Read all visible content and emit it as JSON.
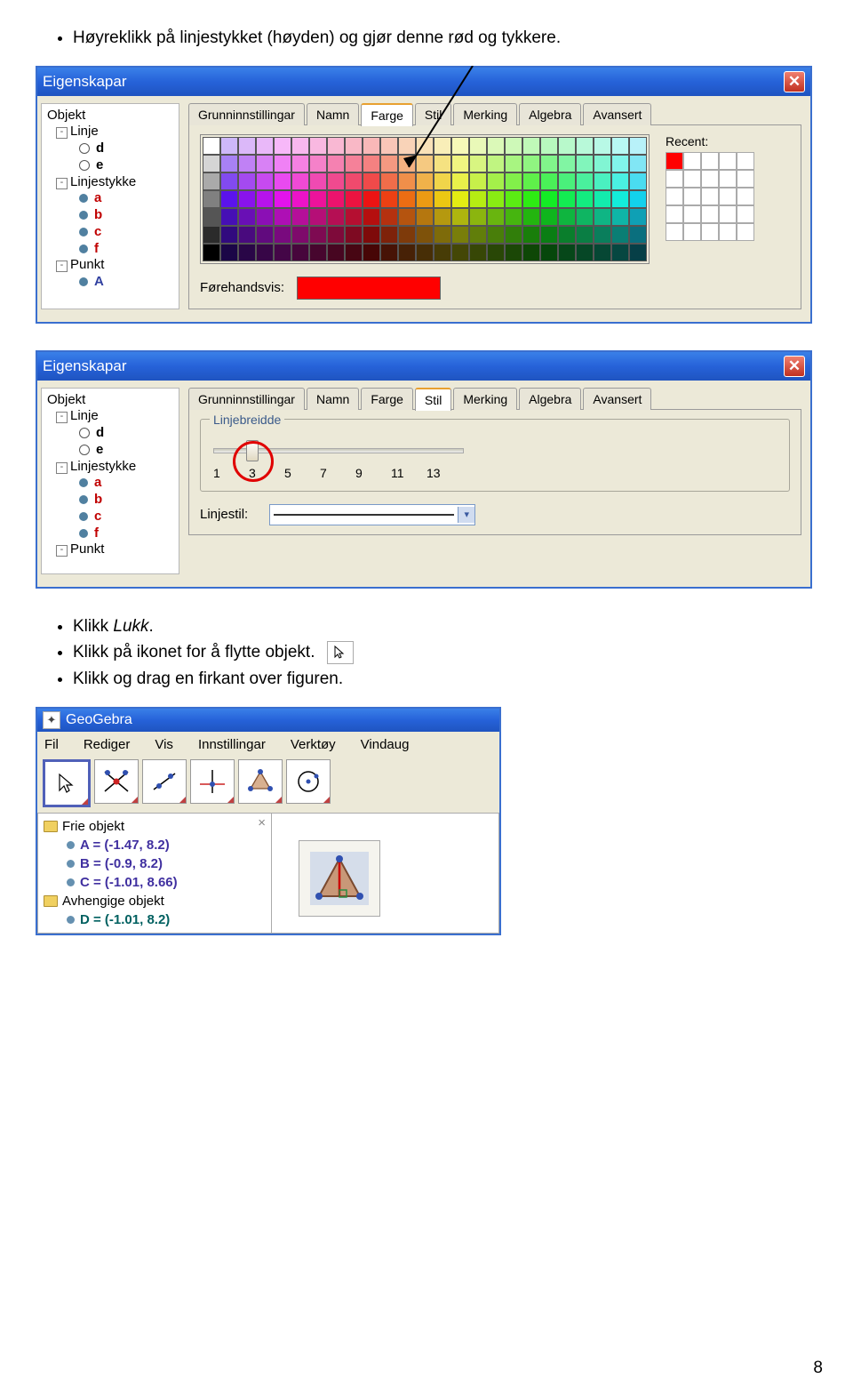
{
  "bullets_top": [
    "Høyreklikk på linjestykket (høyden) og gjør denne rød og tykkere."
  ],
  "bullets_mid": [
    {
      "text": "Klikk ",
      "italic": "Lukk",
      "after": "."
    },
    {
      "text": "Klikk på ikonet for å flytte objekt."
    },
    {
      "text": "Klikk og drag en firkant over figuren."
    }
  ],
  "panel1": {
    "title": "Eigenskapar",
    "tabs": [
      "Grunninnstillingar",
      "Namn",
      "Farge",
      "Stil",
      "Merking",
      "Algebra",
      "Avansert"
    ],
    "active_tab": "Farge",
    "tree_top": "Objekt",
    "tree_linje": "Linje",
    "tree_d": "d",
    "tree_e": "e",
    "tree_ls": "Linjestykke",
    "tree_a": "a",
    "tree_b": "b",
    "tree_c": "c",
    "tree_f": "f",
    "tree_punkt": "Punkt",
    "tree_A": "A",
    "recent_label": "Recent:",
    "preview_label": "Førehandsvis:"
  },
  "panel2": {
    "title": "Eigenskapar",
    "tabs": [
      "Grunninnstillingar",
      "Namn",
      "Farge",
      "Stil",
      "Merking",
      "Algebra",
      "Avansert"
    ],
    "active_tab": "Stil",
    "group_label": "Linjebreidde",
    "ticks": [
      "1",
      "3",
      "5",
      "7",
      "9",
      "11",
      "13"
    ],
    "linjestil_label": "Linjestil:"
  },
  "geogebra": {
    "title": "GeoGebra",
    "menu": [
      "Fil",
      "Rediger",
      "Vis",
      "Innstillingar",
      "Verktøy",
      "Vindaug"
    ],
    "free_label": "Frie objekt",
    "A": "A = (-1.47, 8.2)",
    "B": "B = (-0.9, 8.2)",
    "C": "C = (-1.01, 8.66)",
    "dep_label": "Avhengige objekt",
    "D": "D = (-1.01, 8.2)"
  },
  "page_number": "8"
}
